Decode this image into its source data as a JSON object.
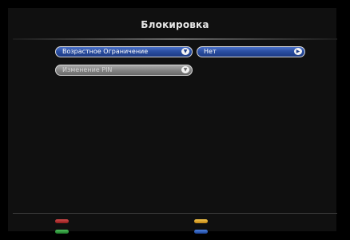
{
  "header": {
    "title": "Блокировка"
  },
  "menu": {
    "items": [
      {
        "label": "Возрастное Ограничение",
        "state": "active"
      },
      {
        "label": "Изменение PIN",
        "state": "inactive"
      }
    ],
    "age_limit_value": "Нет"
  },
  "icons": {
    "dropdown": "chevron-down-icon",
    "next": "chevron-right-icon"
  },
  "color_keys": {
    "red": "#b02a2a",
    "green": "#2f9a3c",
    "yellow": "#e0a626",
    "blue": "#2a5ec2"
  },
  "colors": {
    "active_pill": "#2b4fa2",
    "inactive_pill": "#858585",
    "background": "#000000"
  }
}
